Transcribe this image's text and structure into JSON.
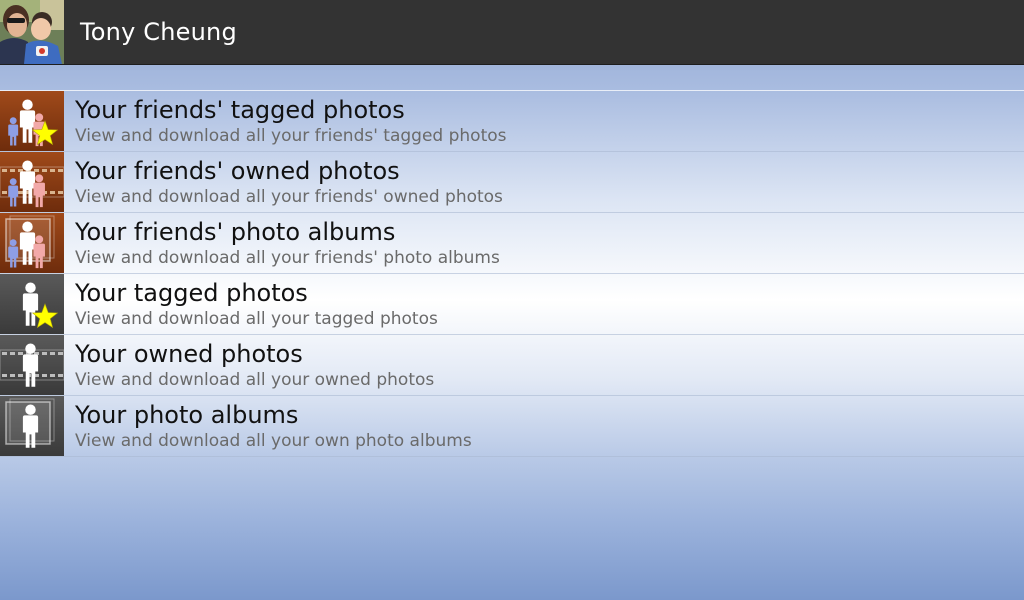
{
  "header": {
    "user_name": "Tony Cheung"
  },
  "menu": {
    "items": [
      {
        "title": "Your friends' tagged photos",
        "subtitle": "View and download all your friends' tagged photos",
        "icon": "friends-tagged-photos-icon",
        "scope": "friends",
        "variant": "tagged"
      },
      {
        "title": "Your friends' owned photos",
        "subtitle": "View and download all your friends' owned photos",
        "icon": "friends-owned-photos-icon",
        "scope": "friends",
        "variant": "owned"
      },
      {
        "title": "Your friends' photo albums",
        "subtitle": "View and download all your friends' photo albums",
        "icon": "friends-photo-albums-icon",
        "scope": "friends",
        "variant": "albums"
      },
      {
        "title": "Your tagged photos",
        "subtitle": "View and download all your tagged photos",
        "icon": "own-tagged-photos-icon",
        "scope": "self",
        "variant": "tagged"
      },
      {
        "title": "Your owned photos",
        "subtitle": "View and download all your owned photos",
        "icon": "own-owned-photos-icon",
        "scope": "self",
        "variant": "owned"
      },
      {
        "title": "Your photo albums",
        "subtitle": "View and download all your own photo albums",
        "icon": "own-photo-albums-icon",
        "scope": "self",
        "variant": "albums"
      }
    ]
  },
  "colors": {
    "header_bg": "#333333",
    "header_text": "#ffffff",
    "title_text": "#111111",
    "subtitle_text": "#6a6a6a",
    "friends_icon_bg": "#8a3a12",
    "self_icon_bg": "#4a4a4a",
    "star": "#ffff00"
  }
}
